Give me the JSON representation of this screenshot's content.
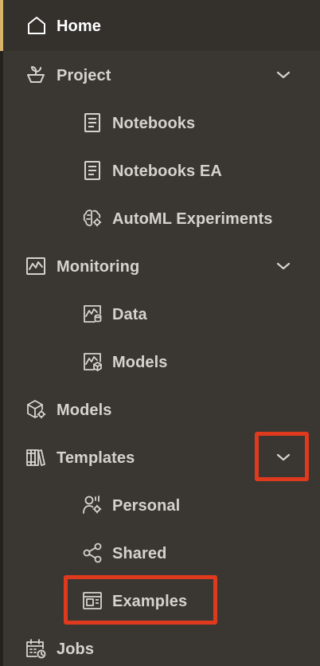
{
  "nav": {
    "home": {
      "label": "Home",
      "icon": "home-icon"
    },
    "project": {
      "label": "Project",
      "icon": "project-icon"
    },
    "notebooks": {
      "label": "Notebooks",
      "icon": "notebook-icon"
    },
    "notebooks_ea": {
      "label": "Notebooks EA",
      "icon": "notebook-icon"
    },
    "automl": {
      "label": "AutoML Experiments",
      "icon": "brain-gear-icon"
    },
    "monitoring": {
      "label": "Monitoring",
      "icon": "monitoring-chart-icon"
    },
    "monitor_data": {
      "label": "Data",
      "icon": "chart-database-icon"
    },
    "monitor_models": {
      "label": "Models",
      "icon": "chart-cube-icon"
    },
    "models": {
      "label": "Models",
      "icon": "models-cube-icon"
    },
    "templates": {
      "label": "Templates",
      "icon": "library-icon"
    },
    "personal": {
      "label": "Personal",
      "icon": "person-gear-icon"
    },
    "shared": {
      "label": "Shared",
      "icon": "share-icon"
    },
    "examples": {
      "label": "Examples",
      "icon": "template-frame-icon"
    },
    "jobs": {
      "label": "Jobs",
      "icon": "calendar-clock-icon"
    }
  },
  "colors": {
    "background": "#3a3733",
    "text": "#d6d3cf",
    "active_text": "#ffffff",
    "accent": "#d9b36a",
    "highlight": "#e03a1e"
  }
}
